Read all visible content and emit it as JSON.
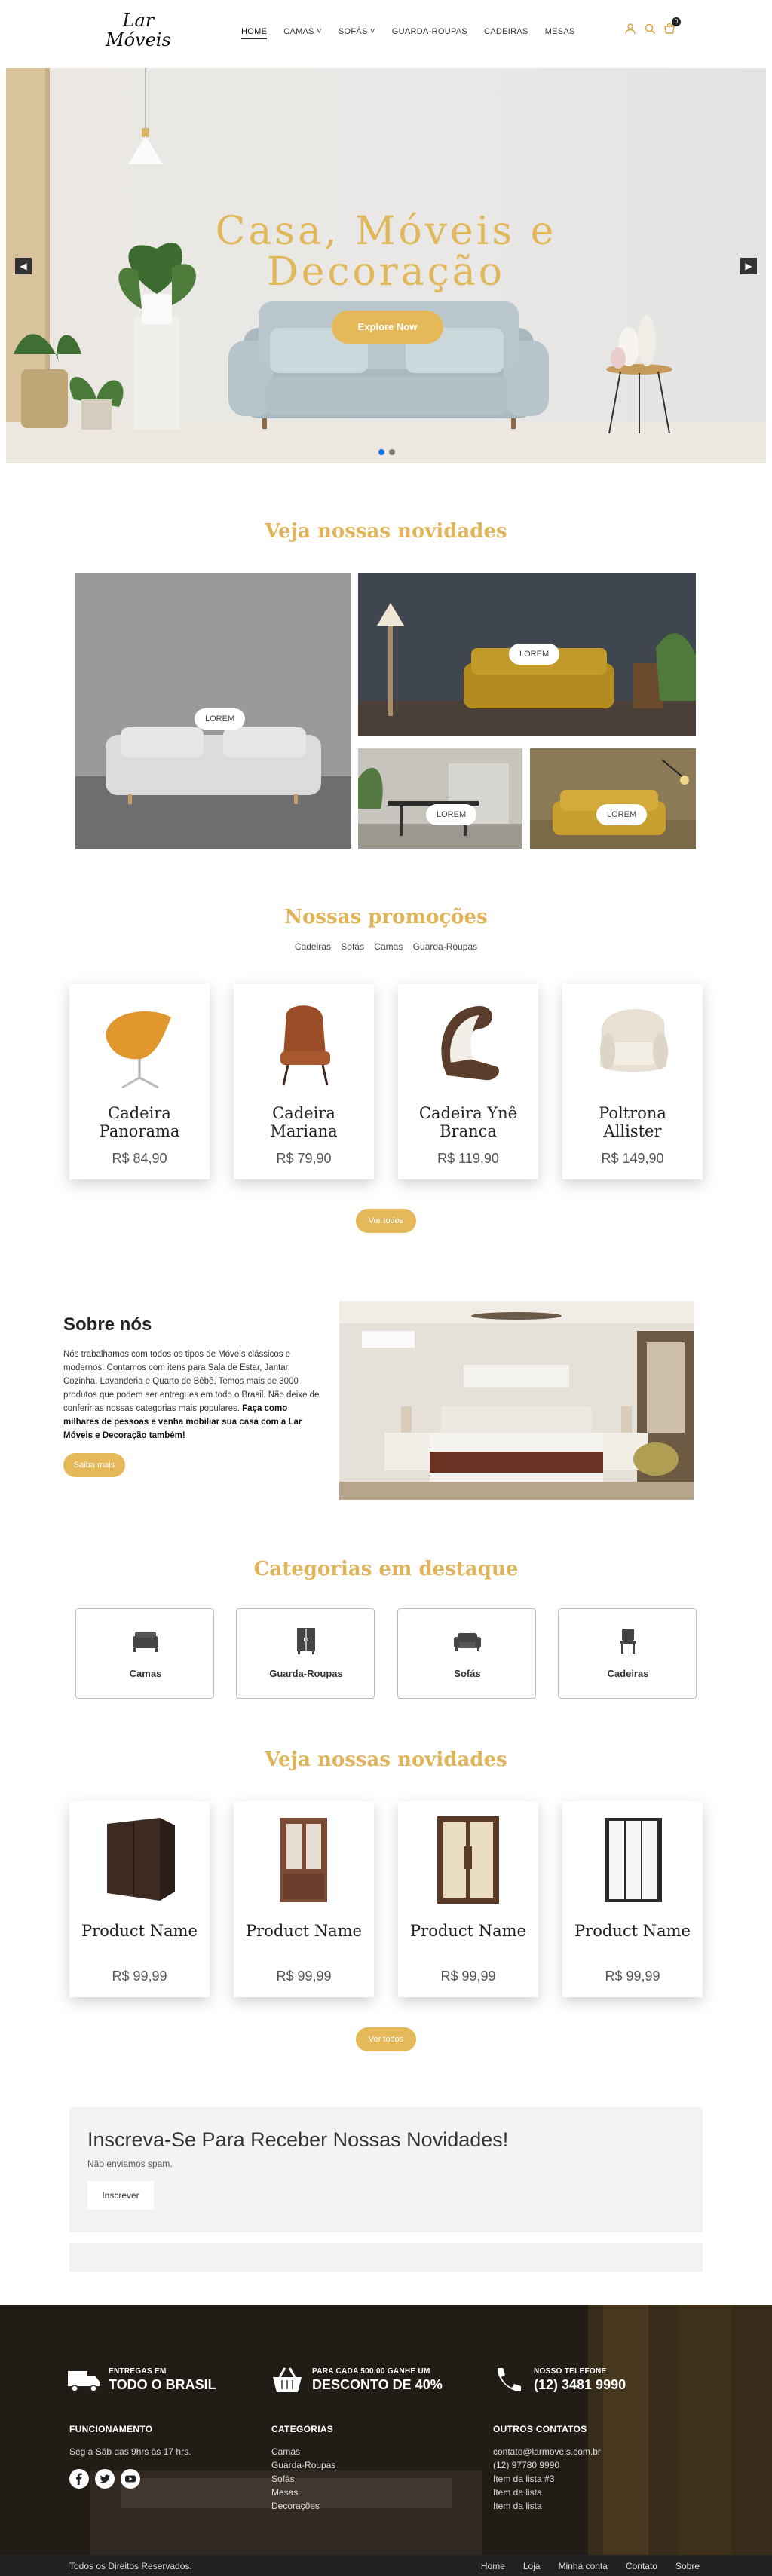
{
  "nav": {
    "logo_line1": "Lar",
    "logo_line2": "Móveis",
    "items": [
      {
        "label": "HOME"
      },
      {
        "label": "CAMAS ˅"
      },
      {
        "label": "SOFÁS ˅"
      },
      {
        "label": "GUARDA-ROUPAS"
      },
      {
        "label": "CADEIRAS"
      },
      {
        "label": "MESAS"
      }
    ],
    "cart_count": "0",
    "icons": [
      "user-icon",
      "search-icon",
      "cart-icon"
    ]
  },
  "hero": {
    "title_line1": "Casa, Móveis e",
    "title_line2": "Decoração",
    "button": "Explore Now",
    "prev": "◀",
    "next": "▶"
  },
  "news": {
    "title": "Veja nossas novidades",
    "tiles": [
      {
        "label": "LOREM"
      },
      {
        "label": "LOREM"
      },
      {
        "label": "LOREM"
      },
      {
        "label": "LOREM"
      }
    ]
  },
  "promo": {
    "title": "Nossas promoções",
    "tabs": [
      "Cadeiras",
      "Sofás",
      "Camas",
      "Guarda-Roupas"
    ],
    "products": [
      {
        "name": "Cadeira Panorama",
        "price": "R$ 84,90"
      },
      {
        "name": "Cadeira Mariana",
        "price": "R$ 79,90"
      },
      {
        "name": "Cadeira Ynê Branca",
        "price": "R$ 119,90"
      },
      {
        "name": "Poltrona Allister",
        "price": "R$ 149,90"
      }
    ],
    "button": "Ver todos"
  },
  "about": {
    "title": "Sobre nós",
    "text": "Nós trabalhamos com todos os tipos de Móveis clássicos e modernos. Contamos com itens para Sala de Estar, Jantar, Cozinha, Lavanderia e Quarto de Bêbê. Temos mais de 3000 produtos que podem ser entregues em todo o Brasil. Não deixe de conferir as nossas categorias mais populares.",
    "text_bold": "Faça como milhares de pessoas e venha mobiliar sua casa com a Lar Móveis e Decoração também!",
    "button": "Saiba mais"
  },
  "categories": {
    "title": "Categorias em destaque",
    "items": [
      {
        "label": "Camas",
        "icon": "bed-icon"
      },
      {
        "label": "Guarda-Roupas",
        "icon": "wardrobe-icon"
      },
      {
        "label": "Sofás",
        "icon": "sofa-icon"
      },
      {
        "label": "Cadeiras",
        "icon": "chair-icon"
      }
    ]
  },
  "news2": {
    "title": "Veja nossas novidades",
    "products": [
      {
        "name": "Product Name",
        "price": "R$ 99,99"
      },
      {
        "name": "Product Name",
        "price": "R$ 99,99"
      },
      {
        "name": "Product Name",
        "price": "R$ 99,99"
      },
      {
        "name": "Product Name",
        "price": "R$ 99,99"
      }
    ],
    "button": "Ver todos"
  },
  "newsletter": {
    "title": "Inscreva-Se Para Receber Nossas Novidades!",
    "subtitle": "Não enviamos spam.",
    "button": "Inscrever"
  },
  "footer": {
    "features": [
      {
        "small": "ENTREGAS EM",
        "big": "TODO O BRASIL",
        "icon": "truck-icon"
      },
      {
        "small": "PARA CADA 500,00 GANHE UM",
        "big": "DESCONTO DE 40%",
        "icon": "basket-icon"
      },
      {
        "small": "NOSSO TELEFONE",
        "big": "(12) 3481 9990",
        "icon": "phone-icon"
      }
    ],
    "col1": {
      "head": "FUNCIONAMENTO",
      "text": "Seg à Sáb das 9hrs às 17 hrs."
    },
    "col2": {
      "head": "CATEGORIAS",
      "items": [
        "Camas",
        "Guarda-Roupas",
        "Sofás",
        "Mesas",
        "Decorações"
      ]
    },
    "col3": {
      "head": "OUTROS CONTATOS",
      "items": [
        "contato@larmoveis.com.br",
        "(12) 97780 9990",
        "Item da lista #3",
        "Item da lista",
        "Item da lista"
      ]
    },
    "social": [
      "facebook-icon",
      "twitter-icon",
      "youtube-icon"
    ],
    "copyright": "Todos os Direitos Reservados.",
    "links": [
      "Home",
      "Loja",
      "Minha conta",
      "Contato",
      "Sobre"
    ]
  },
  "colors": {
    "accent": "#e5b959",
    "title": "#e2b45a"
  }
}
